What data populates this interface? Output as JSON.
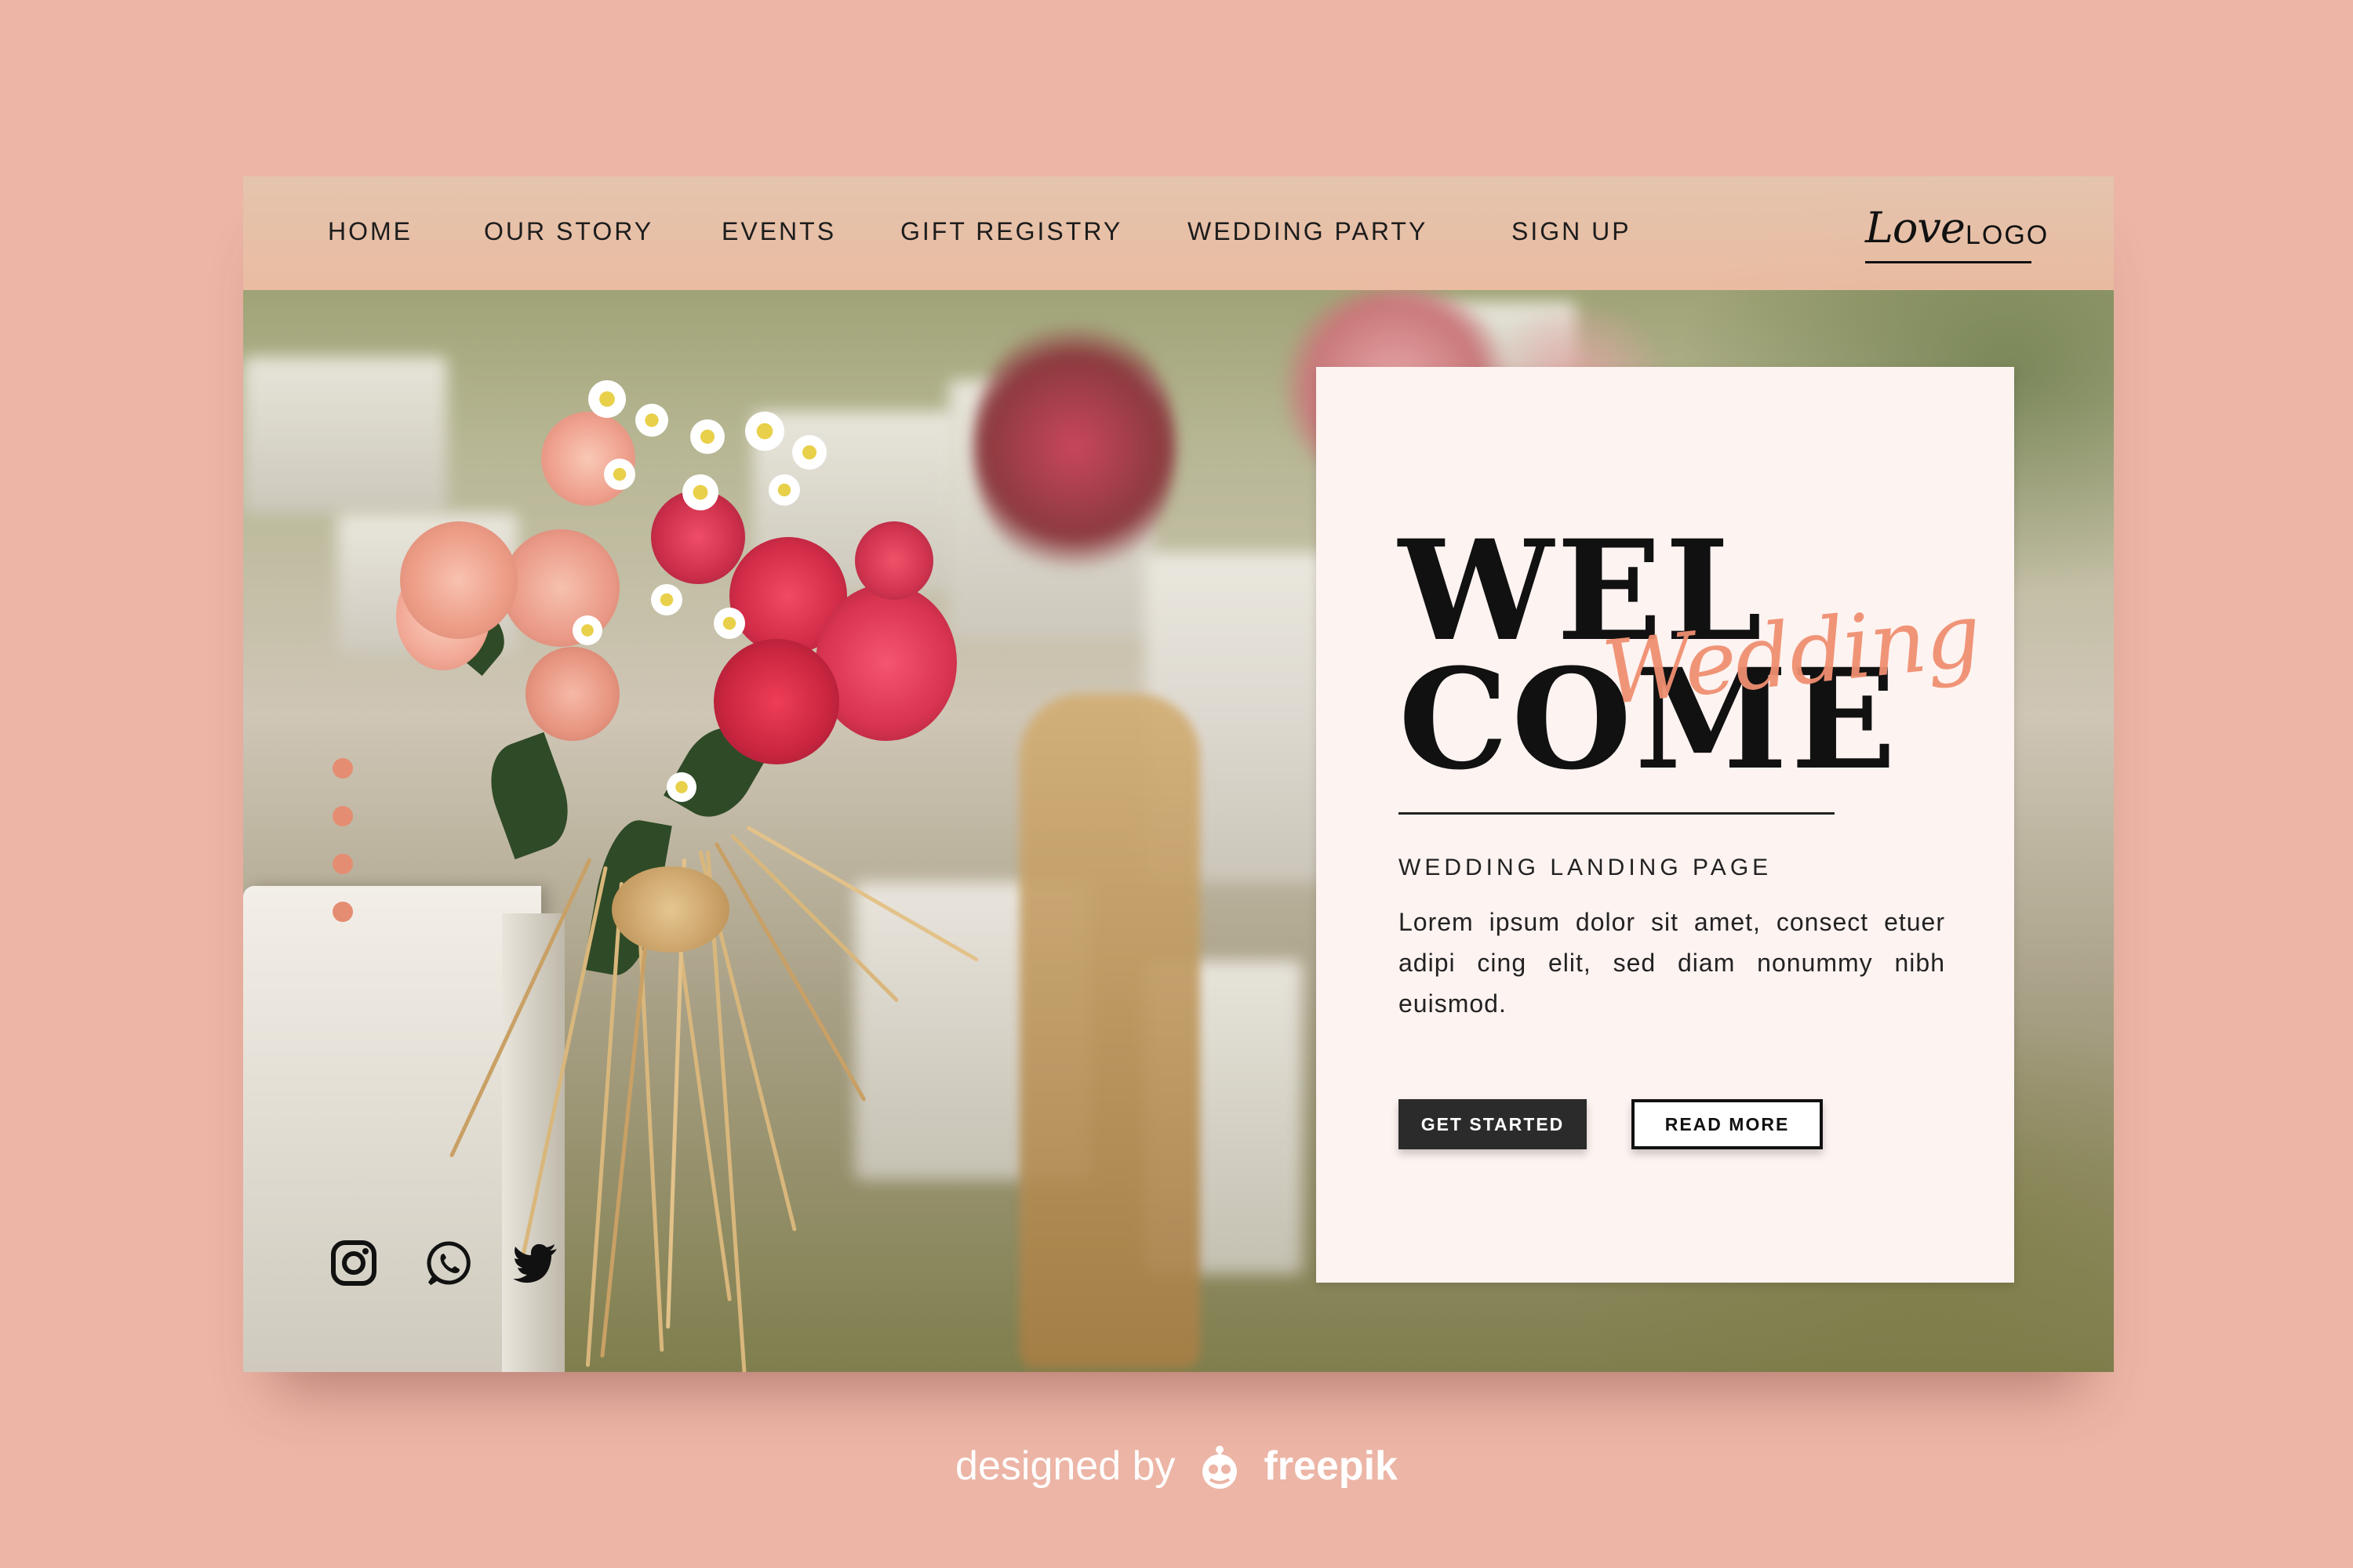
{
  "nav": {
    "items": [
      "HOME",
      "OUR STORY",
      "EVENTS",
      "GIFT REGISTRY",
      "WEDDING PARTY",
      "SIGN UP"
    ]
  },
  "logo": {
    "script": "Love",
    "text": "LOGO"
  },
  "slider": {
    "total": 4
  },
  "social": {
    "icons": [
      "instagram-icon",
      "whatsapp-icon",
      "twitter-icon"
    ]
  },
  "card": {
    "welcome_top": "WEL",
    "welcome_bottom": "COME",
    "script": "Wedding",
    "subtitle": "WEDDING LANDING PAGE",
    "body": "Lorem ipsum dolor sit amet, consect etuer adipi cing elit, sed diam nonummy nibh euismod.",
    "primary_button": "GET STARTED",
    "secondary_button": "READ MORE"
  },
  "colors": {
    "background": "#ecb5a6",
    "accent": "#f08f71",
    "dots": "#e58d72",
    "card": "#fdf3f1",
    "dark": "#2b2b2b"
  },
  "footer": {
    "designed_by": "designed by",
    "brand": "freepik"
  }
}
